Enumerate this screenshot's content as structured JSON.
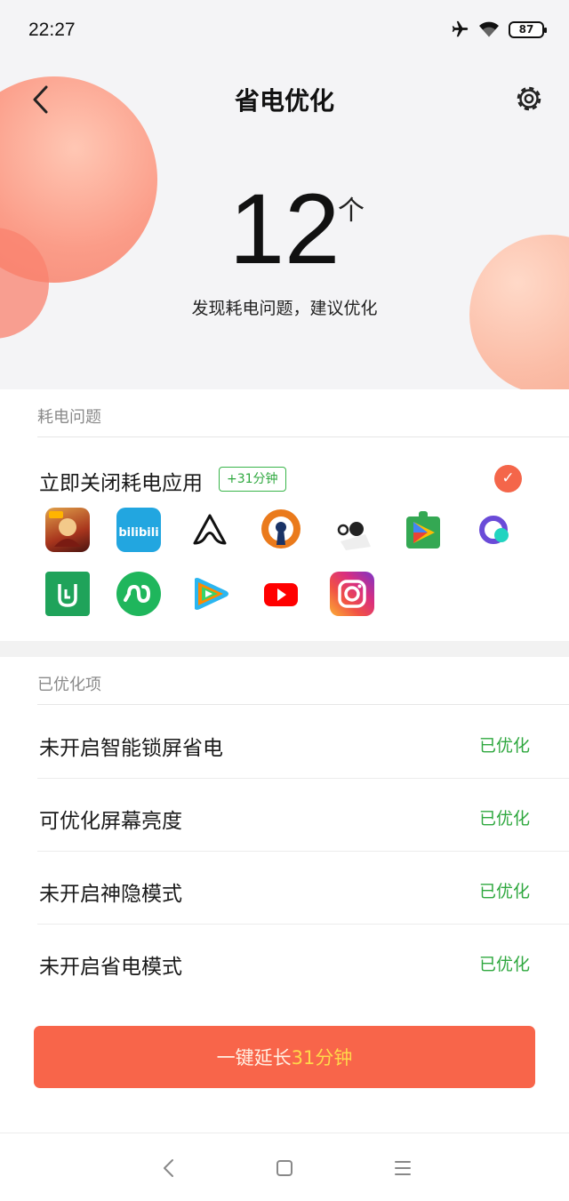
{
  "status_bar": {
    "time": "22:27",
    "battery": "87",
    "icons": [
      "airplane-icon",
      "wifi-icon",
      "battery-icon"
    ]
  },
  "header": {
    "title": "省电优化",
    "back_icon": "back-arrow-icon",
    "settings_icon": "gear-icon"
  },
  "summary": {
    "count": "12",
    "unit": "个",
    "subtitle": "发现耗电问题，建议优化"
  },
  "issues": {
    "section_label": "耗电问题",
    "title": "立即关闭耗电应用",
    "badge": "+31分钟",
    "checked": true,
    "apps": [
      "honor-of-kings-icon",
      "bilibili-icon",
      "aweme-icon",
      "openvpn-icon",
      "dots-app-icon",
      "google-play-services-icon",
      "q-app-icon",
      "mi-home-icon",
      "infinity-app-icon",
      "tencent-video-icon",
      "youtube-icon",
      "instagram-icon"
    ]
  },
  "optimized": {
    "section_label": "已优化项",
    "items": [
      {
        "label": "未开启智能锁屏省电",
        "status": "已优化"
      },
      {
        "label": "可优化屏幕亮度",
        "status": "已优化"
      },
      {
        "label": "未开启神隐模式",
        "status": "已优化"
      },
      {
        "label": "未开启省电模式",
        "status": "已优化"
      }
    ]
  },
  "cta": {
    "prefix": "一键延长",
    "highlight": "31分钟"
  },
  "nav": {
    "icons": [
      "nav-back-icon",
      "nav-home-icon",
      "nav-menu-icon"
    ]
  },
  "colors": {
    "accent": "#f8654a",
    "green": "#2fa83f",
    "highlight": "#ffd84a"
  }
}
